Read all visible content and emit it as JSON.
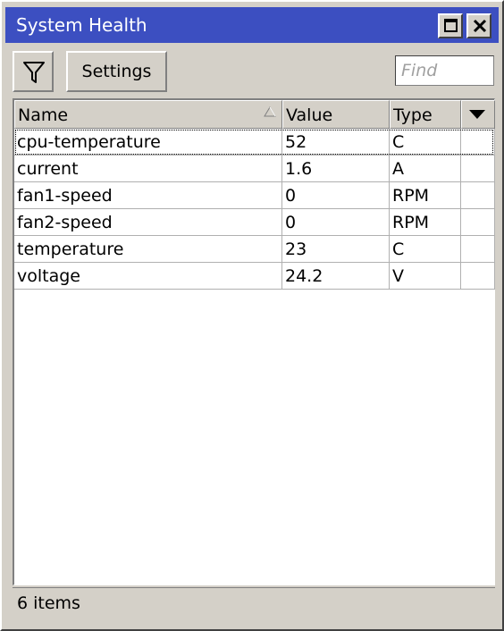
{
  "window": {
    "title": "System Health"
  },
  "toolbar": {
    "settings_label": "Settings"
  },
  "find": {
    "placeholder": "Find"
  },
  "table": {
    "columns": [
      "Name",
      "Value",
      "Type"
    ],
    "rows": [
      {
        "name": "cpu-temperature",
        "value": "52",
        "type": "C"
      },
      {
        "name": "current",
        "value": "1.6",
        "type": "A"
      },
      {
        "name": "fan1-speed",
        "value": "0",
        "type": "RPM"
      },
      {
        "name": "fan2-speed",
        "value": "0",
        "type": "RPM"
      },
      {
        "name": "temperature",
        "value": "23",
        "type": "C"
      },
      {
        "name": "voltage",
        "value": "24.2",
        "type": "V"
      }
    ]
  },
  "status": {
    "text": "6 items"
  },
  "icons": [
    "filter-icon",
    "maximize-icon",
    "close-icon",
    "sort-ascending-icon",
    "column-menu-icon"
  ],
  "colors": {
    "titlebar": "#3c4fc1",
    "panel": "#d4d0c8"
  }
}
